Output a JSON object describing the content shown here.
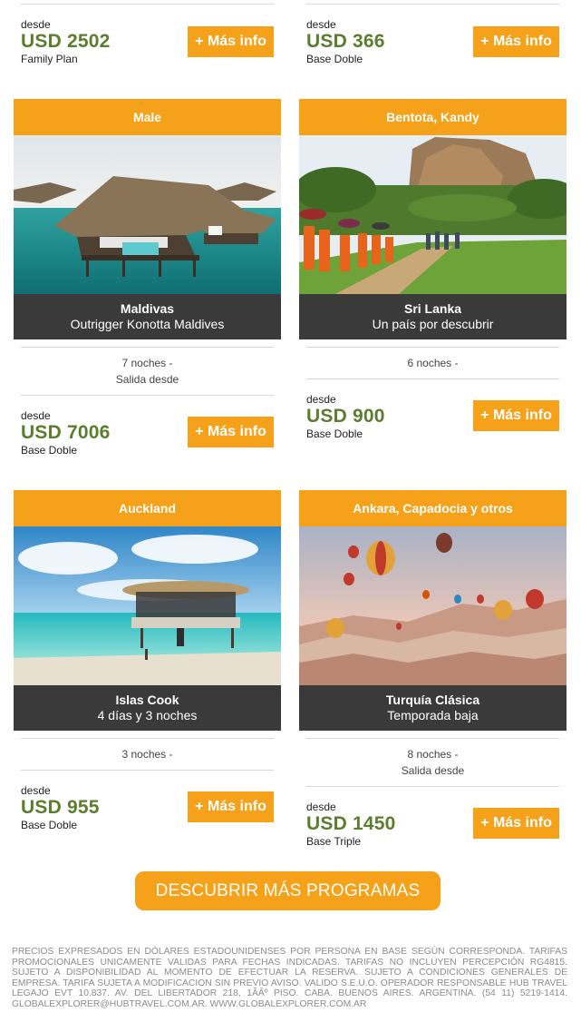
{
  "colors": {
    "accent": "#f5a21a",
    "price": "#5a7d2e",
    "caption_bg": "#3a3a3a"
  },
  "top_row": [
    {
      "desde": "desde",
      "price": "USD 2502",
      "basis": "Family Plan",
      "button": "+ Más info"
    },
    {
      "desde": "desde",
      "price": "USD 366",
      "basis": "Base Doble",
      "button": "+ Más info"
    }
  ],
  "cards": [
    {
      "header": "Male",
      "image_icon": "maldives-overwater-villa-image",
      "title": "Maldivas",
      "subtitle": "Outrigger Konotta Maldives",
      "nights": "7 noches -",
      "departure": "Salida desde",
      "desde": "desde",
      "price": "USD 7006",
      "basis": "Base Doble",
      "button": "+ Más info"
    },
    {
      "header": "Bentota, Kandy",
      "image_icon": "sigiriya-monks-image",
      "title": "Sri Lanka",
      "subtitle": "Un país por descubrir",
      "nights": "6 noches -",
      "departure": "",
      "desde": "desde",
      "price": "USD 900",
      "basis": "Base Doble",
      "button": "+ Más info"
    },
    {
      "header": "Auckland",
      "image_icon": "cook-islands-lagoon-image",
      "title": "Islas Cook",
      "subtitle": "4 días y 3 noches",
      "nights": "3 noches -",
      "departure": "",
      "desde": "desde",
      "price": "USD 955",
      "basis": "Base Doble",
      "button": "+ Más info"
    },
    {
      "header": "Ankara, Capadocia y otros",
      "image_icon": "cappadocia-balloons-image",
      "title": "Turquía Clásica",
      "subtitle": "Temporada baja",
      "nights": "8 noches -",
      "departure": "Salida desde",
      "desde": "desde",
      "price": "USD 1450",
      "basis": "Base Triple",
      "button": "+ Más info"
    }
  ],
  "cta": "DESCUBRIR MÁS PROGRAMAS",
  "legal": "PRECIOS EXPRESADOS EN DÓLARES ESTADOUNIDENSES POR PERSONA EN BASE SEGÚN CORRESPONDA. TARIFAS PROMOCIONALES UNICAMENTE VALIDAS PARA FECHAS INDICADAS. TARIFAS NO INCLUYEN PERCEPCIÓN RG4815. SUJETO A DISPONIBILIDAD AL MOMENTO DE EFECTUAR LA RESERVA. SUJETO A CONDICIONES GENERALES DE EMPRESA. TARIFA SUJETA A MODIFICACION SIN PREVIO AVISO. VALIDO S.E.U.O. OPERADOR RESPONSABLE HUB TRAVEL LEGAJO EVT 10.837. AV. DEL LIBERTADOR 218, 1ÃÂº PISO. CABA. BUENOS AIRES. ARGENTINA. (54 11) 5219-1414. GLOBALEXPLORER@HUBTRAVEL.COM.AR. WWW.GLOBALEXPLORER.COM.AR"
}
